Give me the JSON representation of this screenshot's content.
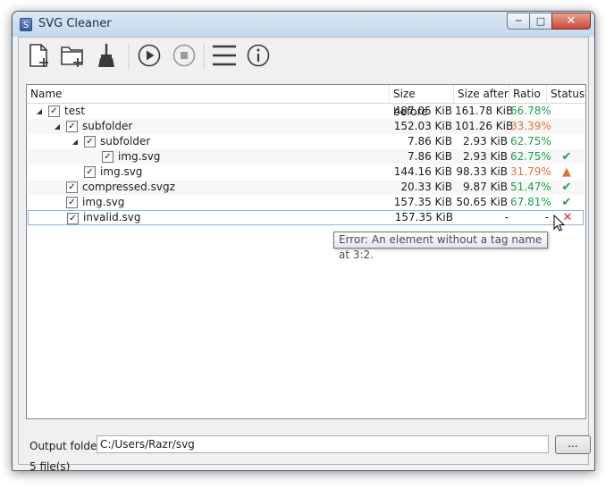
{
  "window": {
    "title": "SVG Cleaner",
    "app_icon_glyph": "S",
    "min_glyph": "─",
    "max_glyph": "□",
    "close_glyph": "✕"
  },
  "toolbar": {
    "buttons": [
      {
        "name": "add-file-icon",
        "tooltip": ""
      },
      {
        "name": "add-folder-icon",
        "tooltip": ""
      },
      {
        "name": "clear-broom-icon",
        "tooltip": ""
      },
      {
        "name": "play-icon",
        "tooltip": ""
      },
      {
        "name": "stop-icon",
        "tooltip": ""
      },
      {
        "name": "menu-icon",
        "tooltip": ""
      },
      {
        "name": "info-icon",
        "tooltip": ""
      }
    ]
  },
  "tree": {
    "columns": [
      "Name",
      "Size before",
      "Size after",
      "Ratio",
      "Status"
    ],
    "rows": [
      {
        "name": "test",
        "before": "487.05 KiB",
        "after": "161.78 KiB",
        "ratio": "66.78%",
        "ratio_color": "#1e9e4a",
        "status": "",
        "level": 0,
        "expander": "◢",
        "checked": true
      },
      {
        "name": "subfolder",
        "before": "152.03 KiB",
        "after": "101.26 KiB",
        "ratio": "33.39%",
        "ratio_color": "#e0703a",
        "status": "",
        "level": 1,
        "expander": "◢",
        "checked": true
      },
      {
        "name": "subfolder",
        "before": "7.86 KiB",
        "after": "2.93 KiB",
        "ratio": "62.75%",
        "ratio_color": "#1e9e4a",
        "status": "",
        "level": 2,
        "expander": "◢",
        "checked": true
      },
      {
        "name": "img.svg",
        "before": "7.86 KiB",
        "after": "2.93 KiB",
        "ratio": "62.75%",
        "ratio_color": "#1e9e4a",
        "status": "ok",
        "level": 3,
        "expander": "",
        "checked": true
      },
      {
        "name": "img.svg",
        "before": "144.16 KiB",
        "after": "98.33 KiB",
        "ratio": "31.79%",
        "ratio_color": "#e0703a",
        "status": "warning",
        "level": 2,
        "expander": "",
        "checked": true
      },
      {
        "name": "compressed.svgz",
        "before": "20.33 KiB",
        "after": "9.87 KiB",
        "ratio": "51.47%",
        "ratio_color": "#1e9e4a",
        "status": "ok",
        "level": 1,
        "expander": "",
        "checked": true
      },
      {
        "name": "img.svg",
        "before": "157.35 KiB",
        "after": "50.65 KiB",
        "ratio": "67.81%",
        "ratio_color": "#1e9e4a",
        "status": "ok",
        "level": 1,
        "expander": "",
        "checked": true
      },
      {
        "name": "invalid.svg",
        "before": "157.35 KiB",
        "after": "-",
        "ratio": "-",
        "ratio_color": "#1b1b1b",
        "status": "error",
        "level": 1,
        "expander": "",
        "checked": true
      }
    ]
  },
  "tooltip": {
    "text": "Error: An element without a tag name at 3:2."
  },
  "output": {
    "label": "Output folder:",
    "value": "C:/Users/Razr/svg",
    "browse_label": "..."
  },
  "status_bar": {
    "text": "5 file(s)"
  },
  "colors": {
    "ok": "#1e9e4a",
    "warning": "#e0703a",
    "error": "#e0203c"
  },
  "status_glyphs": {
    "ok": "✔",
    "warning": "▲",
    "error": "✕"
  }
}
